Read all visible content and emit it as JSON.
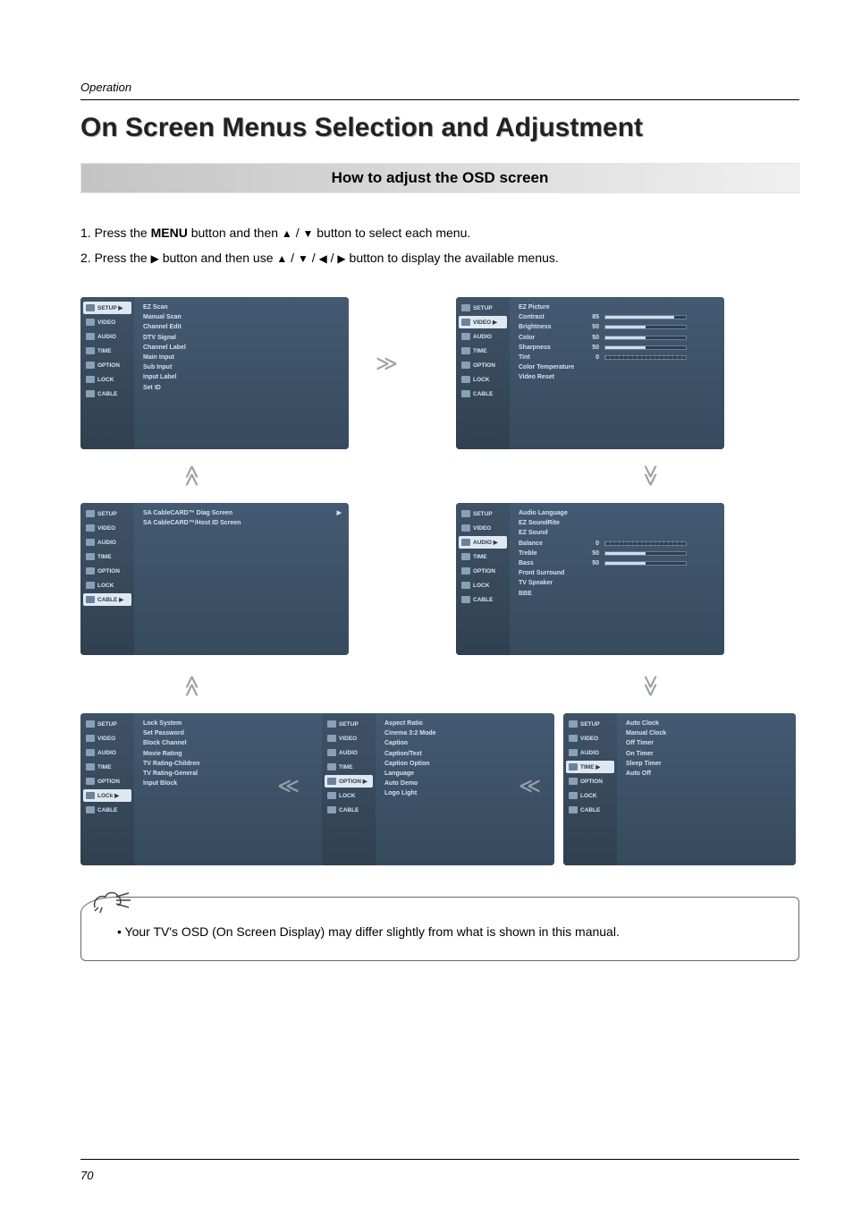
{
  "header": {
    "section": "Operation"
  },
  "title": "On Screen Menus Selection and Adjustment",
  "subhead": "How to adjust the OSD screen",
  "instructions": {
    "step1_pre": "1. Press the ",
    "step1_menu": "MENU",
    "step1_mid": " button and then ",
    "step1_post": " button to select each menu.",
    "step2_pre": "2. Press the ",
    "step2_mid": " button and then use ",
    "step2_post": " button to display the available menus.",
    "up": "▲",
    "down": "▼",
    "left": "◀",
    "right": "▶",
    "sep": " / "
  },
  "side_labels": {
    "setup": "SETUP",
    "video": "VIDEO",
    "audio": "AUDIO",
    "time": "TIME",
    "option": "OPTION",
    "lock": "LOCK",
    "cable": "CABLE"
  },
  "panels": {
    "setup": {
      "active": "SETUP",
      "items": [
        "EZ Scan",
        "Manual Scan",
        "Channel Edit",
        "DTV Signal",
        "Channel Label",
        "Main Input",
        "Sub Input",
        "Input Label",
        "Set ID"
      ]
    },
    "video": {
      "active": "VIDEO",
      "items": [
        {
          "label": "EZ Picture"
        },
        {
          "label": "Contrast",
          "value": 85
        },
        {
          "label": "Brightness",
          "value": 50
        },
        {
          "label": "Color",
          "value": 50
        },
        {
          "label": "Sharpness",
          "value": 50
        },
        {
          "label": "Tint",
          "value": 0,
          "centered": true
        },
        {
          "label": "Color Temperature"
        },
        {
          "label": "Video Reset"
        }
      ]
    },
    "audio": {
      "active": "AUDIO",
      "items": [
        {
          "label": "Audio Language"
        },
        {
          "label": "EZ SoundRite"
        },
        {
          "label": "EZ Sound"
        },
        {
          "label": "Balance",
          "value": 0,
          "centered": true
        },
        {
          "label": "Treble",
          "value": 50
        },
        {
          "label": "Bass",
          "value": 50
        },
        {
          "label": "Front Surround"
        },
        {
          "label": "TV Speaker"
        },
        {
          "label": "BBE"
        }
      ]
    },
    "time": {
      "active": "TIME",
      "items": [
        "Auto Clock",
        "Manual Clock",
        "Off Timer",
        "On Timer",
        "Sleep Timer",
        "Auto Off"
      ]
    },
    "option": {
      "active": "OPTION",
      "items": [
        "Aspect Ratio",
        "Cinema 3:2 Mode",
        "Caption",
        "Caption/Text",
        "Caption Option",
        "Language",
        "Auto Demo",
        "Logo Light"
      ]
    },
    "lock": {
      "active": "LOCk",
      "items": [
        "Lock System",
        "Set Password",
        "Block Channel",
        "Movie Rating",
        "TV Rating-Children",
        "TV Rating-General",
        "Input Block"
      ]
    },
    "cable": {
      "active": "CABLE",
      "items": [
        "SA CableCARD™ Diag Screen",
        "SA CableCARD™/Host ID Screen"
      ]
    }
  },
  "note": {
    "bullet": "• ",
    "text": "Your TV's OSD (On Screen Display) may differ slightly from what is shown in this manual."
  },
  "page_number": "70",
  "arrow_marker": "▶"
}
